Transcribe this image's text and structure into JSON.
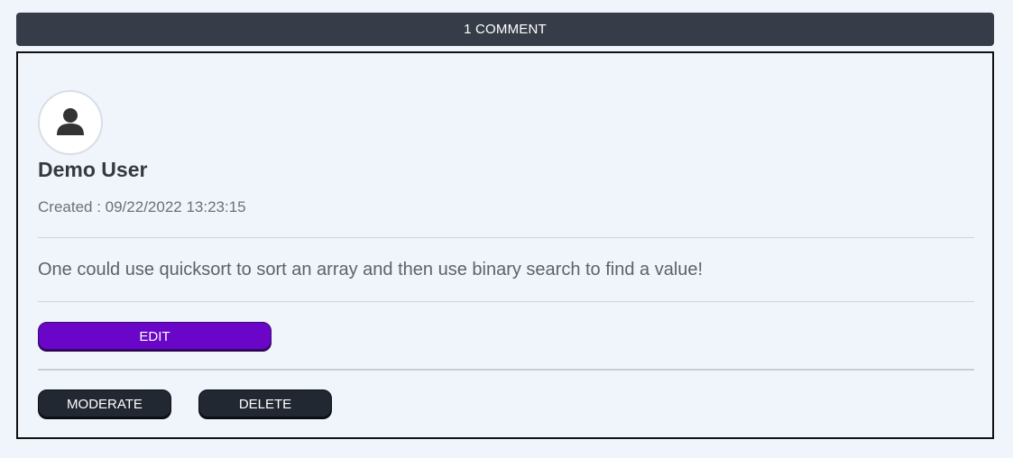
{
  "header": {
    "comment_count_label": "1 COMMENT"
  },
  "comment": {
    "user_name": "Demo User",
    "created_label": "Created : 09/22/2022 13:23:15",
    "body": "One could use quicksort to sort an array and then use binary search to find a value!",
    "avatar_icon": "user-silhouette-icon"
  },
  "actions": {
    "edit_label": "EDIT",
    "moderate_label": "MODERATE",
    "delete_label": "DELETE"
  },
  "colors": {
    "header_bg": "#363d48",
    "edit_button": "#6a06c8",
    "dark_button": "#222831",
    "page_bg": "#f0f4fb"
  }
}
